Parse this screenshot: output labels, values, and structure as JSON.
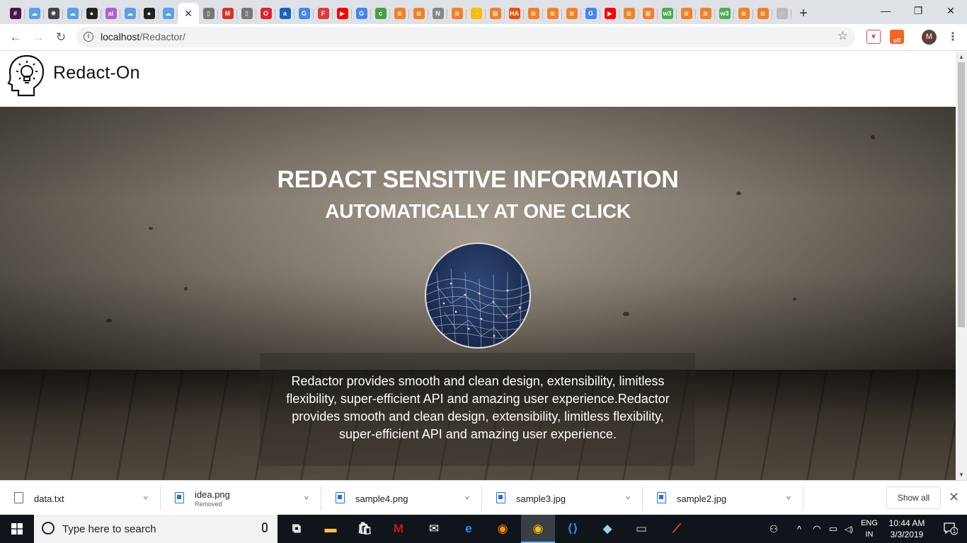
{
  "browser": {
    "window_controls": {
      "minimize": "—",
      "maximize": "❐",
      "close": "✕"
    },
    "new_tab": "+",
    "active_tab_close": "✕",
    "tabs": [
      {
        "icon": "slack-icon",
        "color": "#4a154b",
        "glyph": "#"
      },
      {
        "icon": "cloud-icon",
        "color": "#5aa0e6",
        "glyph": "☁"
      },
      {
        "icon": "bug-icon",
        "color": "#444444",
        "glyph": "✺"
      },
      {
        "icon": "cloud-icon",
        "color": "#5aa0e6",
        "glyph": "☁"
      },
      {
        "icon": "github-icon",
        "color": "#222222",
        "glyph": "●"
      },
      {
        "icon": "ai-icon",
        "color": "#b05fd8",
        "glyph": "ai"
      },
      {
        "icon": "cloud-icon",
        "color": "#5aa0e6",
        "glyph": "☁"
      },
      {
        "icon": "github-icon",
        "color": "#222222",
        "glyph": "●"
      },
      {
        "icon": "cloud-icon",
        "color": "#5aa0e6",
        "glyph": "☁"
      },
      {
        "icon": "document-icon",
        "color": "#777777",
        "glyph": "▯"
      },
      {
        "icon": "gmail-icon",
        "color": "#d93025",
        "glyph": "M"
      },
      {
        "icon": "document-icon",
        "color": "#777777",
        "glyph": "▯"
      },
      {
        "icon": "opera-icon",
        "color": "#e0222c",
        "glyph": "O"
      },
      {
        "icon": "app-icon",
        "color": "#1565c0",
        "glyph": "a"
      },
      {
        "icon": "google-icon",
        "color": "#4285f4",
        "glyph": "G"
      },
      {
        "icon": "f-icon",
        "color": "#e53935",
        "glyph": "F"
      },
      {
        "icon": "youtube-icon",
        "color": "#ff0000",
        "glyph": "▶"
      },
      {
        "icon": "google-icon",
        "color": "#4285f4",
        "glyph": "G"
      },
      {
        "icon": "c-icon",
        "color": "#43a047",
        "glyph": "c"
      },
      {
        "icon": "stackoverflow-icon",
        "color": "#f48024",
        "glyph": "≋"
      },
      {
        "icon": "stackoverflow-icon",
        "color": "#f48024",
        "glyph": "≋"
      },
      {
        "icon": "n-icon",
        "color": "#888888",
        "glyph": "N"
      },
      {
        "icon": "stackoverflow-icon",
        "color": "#f48024",
        "glyph": "≋"
      },
      {
        "icon": "chrome-icon",
        "color": "#fbbc05",
        "glyph": "◔"
      },
      {
        "icon": "xampp-icon",
        "color": "#fb7a24",
        "glyph": "⊠"
      },
      {
        "icon": "ha-icon",
        "color": "#e65100",
        "glyph": "HA"
      },
      {
        "icon": "stackoverflow-icon",
        "color": "#f48024",
        "glyph": "≋"
      },
      {
        "icon": "stackoverflow-icon",
        "color": "#f48024",
        "glyph": "≋"
      },
      {
        "icon": "stackoverflow-icon",
        "color": "#f48024",
        "glyph": "≋"
      },
      {
        "icon": "google-icon",
        "color": "#4285f4",
        "glyph": "G"
      },
      {
        "icon": "youtube-icon",
        "color": "#ff0000",
        "glyph": "▶"
      },
      {
        "icon": "stackoverflow-icon",
        "color": "#f48024",
        "glyph": "≋"
      },
      {
        "icon": "xampp-icon",
        "color": "#fb7a24",
        "glyph": "⊠"
      },
      {
        "icon": "w3schools-icon",
        "color": "#4caf50",
        "glyph": "w3"
      },
      {
        "icon": "stackoverflow-icon",
        "color": "#f48024",
        "glyph": "≋"
      },
      {
        "icon": "stackoverflow-icon",
        "color": "#f48024",
        "glyph": "≋"
      },
      {
        "icon": "w3schools-icon",
        "color": "#4caf50",
        "glyph": "w3"
      },
      {
        "icon": "stackoverflow-icon",
        "color": "#f48024",
        "glyph": "≋"
      },
      {
        "icon": "stackoverflow-icon",
        "color": "#f48024",
        "glyph": "≋"
      },
      {
        "icon": "loading-icon",
        "color": "#bbbbbb",
        "glyph": "◌"
      }
    ],
    "nav": {
      "back": "←",
      "forward": "→",
      "reload": "↻"
    },
    "address": {
      "host": "localhost",
      "path": "/Redactor/"
    },
    "star": "☆",
    "extensions": [
      {
        "icon": "pocket-icon",
        "color": "#ef4056",
        "glyph": "▼"
      },
      {
        "icon": "extension-off-icon",
        "color": "#f26522",
        "glyph": "off"
      }
    ],
    "profile_initial": "M",
    "menu": "⋮"
  },
  "site": {
    "brand": "Redact-On",
    "hero": {
      "title": "REDACT SENSITIVE INFORMATION",
      "subtitle": "AUTOMATICALLY AT ONE CLICK",
      "description": "Redactor provides smooth and clean design, extensibility, limitless flexibility, super-efficient API and amazing user experience.Redactor provides smooth and clean design, extensibility, limitless flexibility, super-efficient API and amazing user experience."
    }
  },
  "downloads": {
    "items": [
      {
        "name": "data.txt",
        "status": "",
        "type": "text"
      },
      {
        "name": "idea.png",
        "status": "Removed",
        "type": "image"
      },
      {
        "name": "sample4.png",
        "status": "",
        "type": "image"
      },
      {
        "name": "sample3.jpg",
        "status": "",
        "type": "image"
      },
      {
        "name": "sample2.jpg",
        "status": "",
        "type": "image"
      }
    ],
    "show_all": "Show all",
    "close": "✕",
    "chevron": "^"
  },
  "taskbar": {
    "search_placeholder": "Type here to search",
    "apps": [
      {
        "icon": "task-view-icon",
        "color": "#ffffff",
        "glyph": "⧉",
        "active": false
      },
      {
        "icon": "file-explorer-icon",
        "color": "#f8c33a",
        "glyph": "▬",
        "active": false
      },
      {
        "icon": "store-icon",
        "color": "#ffffff",
        "glyph": "🛍",
        "active": false
      },
      {
        "icon": "mcafee-icon",
        "color": "#c01818",
        "glyph": "M",
        "active": false
      },
      {
        "icon": "mail-icon",
        "color": "#ffffff",
        "glyph": "✉",
        "active": false
      },
      {
        "icon": "edge-icon",
        "color": "#1e90ff",
        "glyph": "e",
        "active": false
      },
      {
        "icon": "firefox-icon",
        "color": "#ff8a00",
        "glyph": "◉",
        "active": false
      },
      {
        "icon": "chrome-icon",
        "color": "#fbbc05",
        "glyph": "◉",
        "active": true
      },
      {
        "icon": "vscode-icon",
        "color": "#2b91e3",
        "glyph": "⟨⟩",
        "active": false
      },
      {
        "icon": "tablet-icon",
        "color": "#9cd3e8",
        "glyph": "◆",
        "active": false
      },
      {
        "icon": "terminal-icon",
        "color": "#cccccc",
        "glyph": "▭",
        "active": false
      },
      {
        "icon": "brackets-icon",
        "color": "#f25022",
        "glyph": "⟋",
        "active": false
      }
    ],
    "tray": {
      "people": "⚇",
      "chevron": "^",
      "wifi": "◠",
      "battery": "▭",
      "volume": "◁)"
    },
    "lang_top": "ENG",
    "lang_bottom": "IN",
    "time": "10:44 AM",
    "date": "3/3/2019",
    "notifications_count": "1"
  }
}
